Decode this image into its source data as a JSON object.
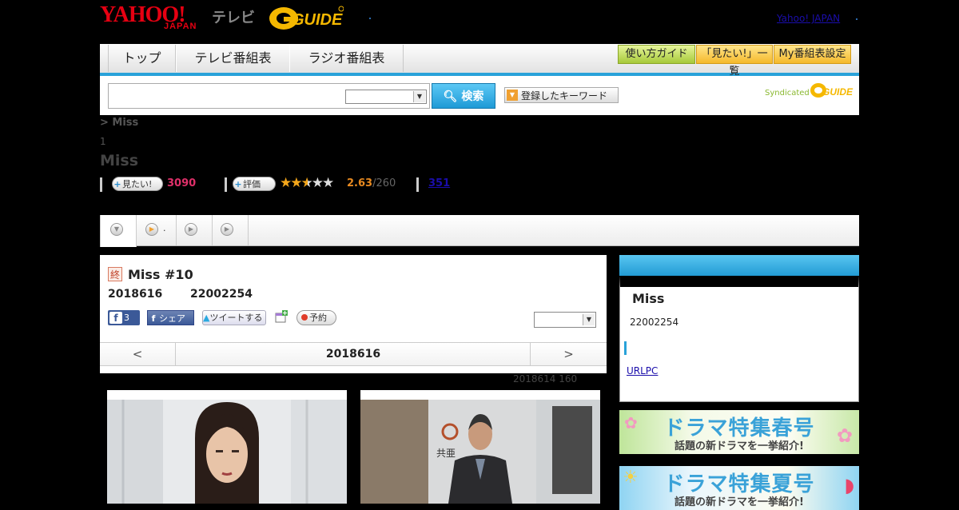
{
  "header": {
    "logo_yahoo": "YAHOO!",
    "logo_japan": "JAPAN",
    "logo_tv": "テレビ",
    "gguide_label": "G-GUIDE",
    "yahoo_japan_link": "Yahoo! JAPAN"
  },
  "nav": {
    "tabs": [
      "トップ",
      "テレビ番組表",
      "ラジオ番組表"
    ],
    "buttons": [
      "使い方ガイド",
      "「見たい!」一覧",
      "My番組表設定"
    ]
  },
  "search": {
    "button_label": "検索",
    "keyword_button": "登録したキーワード",
    "syndicated": "Syndicated"
  },
  "program": {
    "breadcrumb": "> Miss",
    "index": "1",
    "title": "Miss",
    "want_label": "見たい!",
    "want_count": "3090",
    "rate_label": "評価",
    "rating": "2.63",
    "rating_count": "/260",
    "review_count": "351",
    "star_rating": 2.63
  },
  "subtabs": {
    "tab2_label": "."
  },
  "episode": {
    "end_badge": "終",
    "title": "Miss #10",
    "date": "2018616",
    "time": "22002254",
    "fb_count": "3",
    "share_label": "シェア",
    "tweet_label": "ツイートする",
    "reserve_label": "予約",
    "pager_prev": "<",
    "pager_date": "2018616",
    "pager_next": ">",
    "faint_note": "2018614  160"
  },
  "sidebar": {
    "title": "Miss",
    "time": "22002254",
    "link": "URLPC"
  },
  "banners": [
    {
      "title": "ドラマ特集春号",
      "sub": "話題の新ドラマを一挙紹介!"
    },
    {
      "title": "ドラマ特集夏号",
      "sub": "話題の新ドラマを一挙紹介!"
    }
  ],
  "colors": {
    "accent_blue": "#29a2d9",
    "yahoo_red": "#e60012",
    "want_pink": "#e0306a",
    "star_orange": "#f3a61b"
  }
}
